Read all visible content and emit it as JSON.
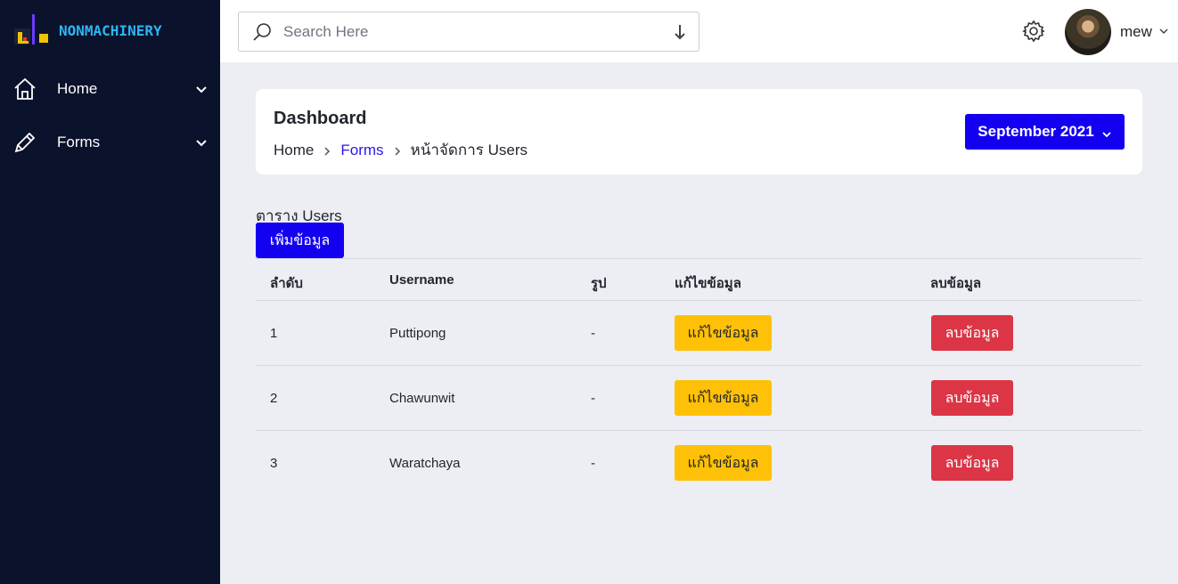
{
  "brand": {
    "name": "NONMACHINERY"
  },
  "sidebar": {
    "items": [
      {
        "label": "Home",
        "icon": "home-icon"
      },
      {
        "label": "Forms",
        "icon": "pencil-icon"
      }
    ]
  },
  "topbar": {
    "search_placeholder": "Search Here",
    "user_name": "mew"
  },
  "header": {
    "title": "Dashboard",
    "breadcrumb": [
      "Home",
      "Forms",
      "หน้าจัดการ Users"
    ],
    "month_label": "September 2021"
  },
  "users_table": {
    "title": "ตาราง Users",
    "add_label": "เพิ่มข้อมูล",
    "columns": [
      "ลำดับ",
      "Username",
      "รูป",
      "แก้ไขข้อมูล",
      "ลบข้อมูล"
    ],
    "rows": [
      {
        "no": "1",
        "username": "Puttipong",
        "photo": "-",
        "edit": "แก้ไขข้อมูล",
        "delete": "ลบข้อมูล"
      },
      {
        "no": "2",
        "username": "Chawunwit",
        "photo": "-",
        "edit": "แก้ไขข้อมูล",
        "delete": "ลบข้อมูล"
      },
      {
        "no": "3",
        "username": "Waratchaya",
        "photo": "-",
        "edit": "แก้ไขข้อมูล",
        "delete": "ลบข้อมูล"
      }
    ]
  },
  "colors": {
    "sidebar_bg": "#0b122b",
    "primary": "#1400f0",
    "warning": "#fec107",
    "danger": "#dc3545",
    "brand_text": "#2bb6f2"
  }
}
